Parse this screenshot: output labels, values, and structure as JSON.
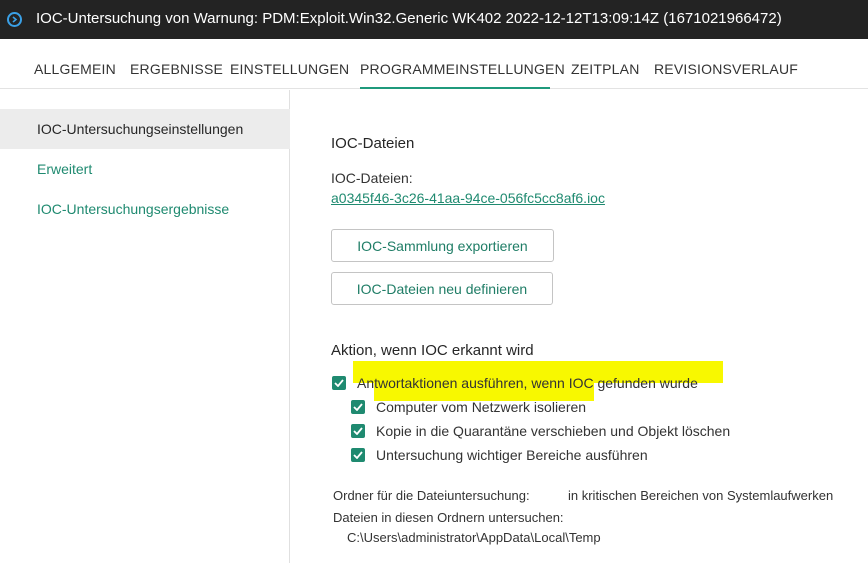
{
  "window": {
    "title": "IOC-Untersuchung von Warnung: PDM:Exploit.Win32.Generic WK402 2022-12-12T13:09:14Z (1671021966472)",
    "icon": "info-circle-icon"
  },
  "tabs": [
    {
      "label": "ALLGEMEIN",
      "active": false
    },
    {
      "label": "ERGEBNISSE",
      "active": false
    },
    {
      "label": "EINSTELLUNGEN",
      "active": false
    },
    {
      "label": "PROGRAMMEINSTELLUNGEN",
      "active": true
    },
    {
      "label": "ZEITPLAN",
      "active": false
    },
    {
      "label": "REVISIONSVERLAUF",
      "active": false
    }
  ],
  "sidebar": {
    "items": [
      {
        "label": "IOC-Untersuchungseinstellungen",
        "selected": true
      },
      {
        "label": "Erweitert",
        "selected": false
      },
      {
        "label": "IOC-Untersuchungsergebnisse",
        "selected": false
      }
    ]
  },
  "ioc_files": {
    "heading": "IOC-Dateien",
    "label": "IOC-Dateien:",
    "file_link": "a0345f46-3c26-41aa-94ce-056fc5cc8af6.ioc",
    "export_button": "IOC-Sammlung exportieren",
    "redefine_button": "IOC-Dateien neu definieren"
  },
  "action": {
    "heading": "Aktion, wenn IOC erkannt wird",
    "checkboxes": [
      {
        "label": "Antwortaktionen ausführen, wenn IOC gefunden wurde",
        "checked": true
      },
      {
        "label": "Computer vom Netzwerk isolieren",
        "checked": true
      },
      {
        "label": "Kopie in die Quarantäne verschieben und Objekt löschen",
        "checked": true
      },
      {
        "label": "Untersuchung wichtiger Bereiche ausführen",
        "checked": true
      }
    ]
  },
  "folder": {
    "label": "Ordner für die Dateiuntersuchung:",
    "value": "in kritischen Bereichen von Systemlaufwerken",
    "scan_label": "Dateien in diesen Ordnern untersuchen:",
    "path": "C:\\Users\\administrator\\AppData\\Local\\Temp"
  },
  "colors": {
    "accent": "#1f8a70",
    "titlebar": "#232323",
    "highlight": "#f8f800"
  }
}
